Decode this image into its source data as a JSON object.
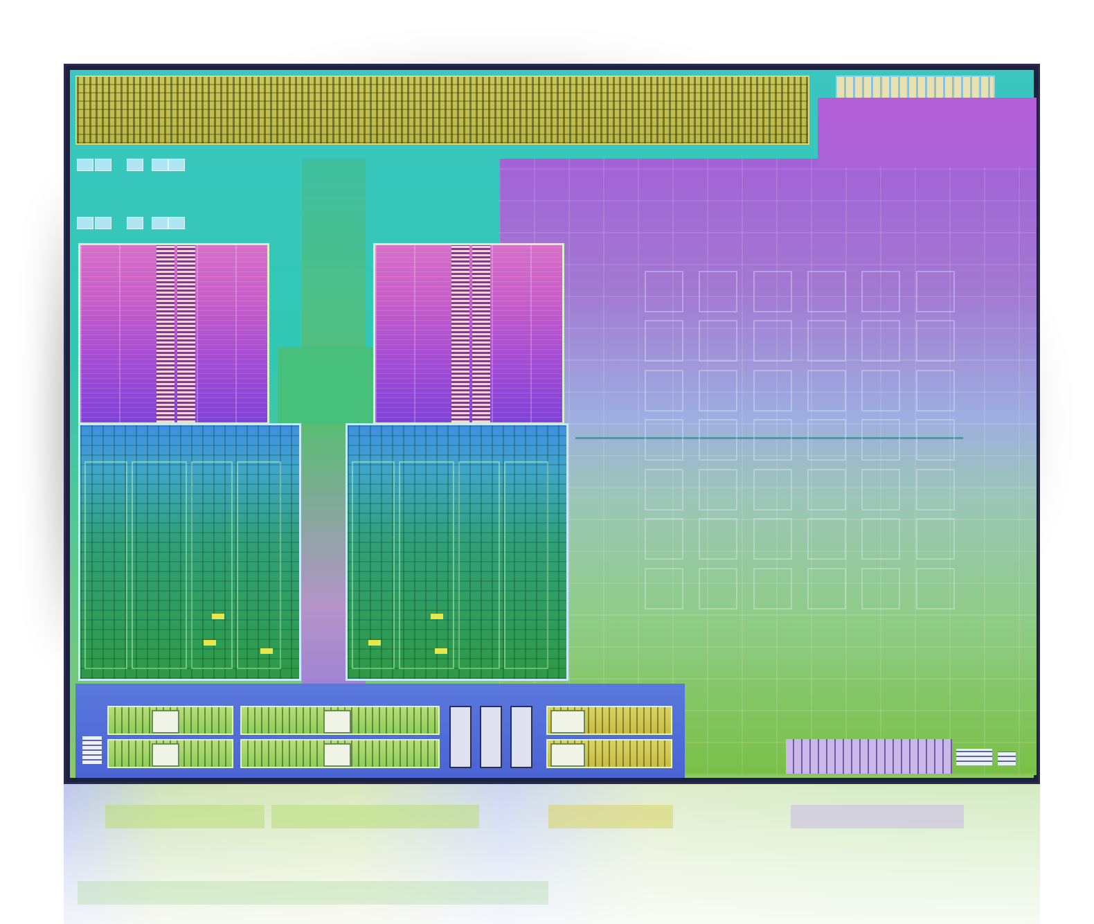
{
  "image": {
    "subject": "processor-die-photo",
    "colors": {
      "background": "#ffffff",
      "io_strip": "#c9c75a",
      "gpu_top": "#a262d6",
      "gpu_bottom": "#79c046",
      "cache": "#c85ec8",
      "core_top": "#3f8fe0",
      "core_bottom": "#2e9a44",
      "io_base": "#4a64d4"
    }
  }
}
